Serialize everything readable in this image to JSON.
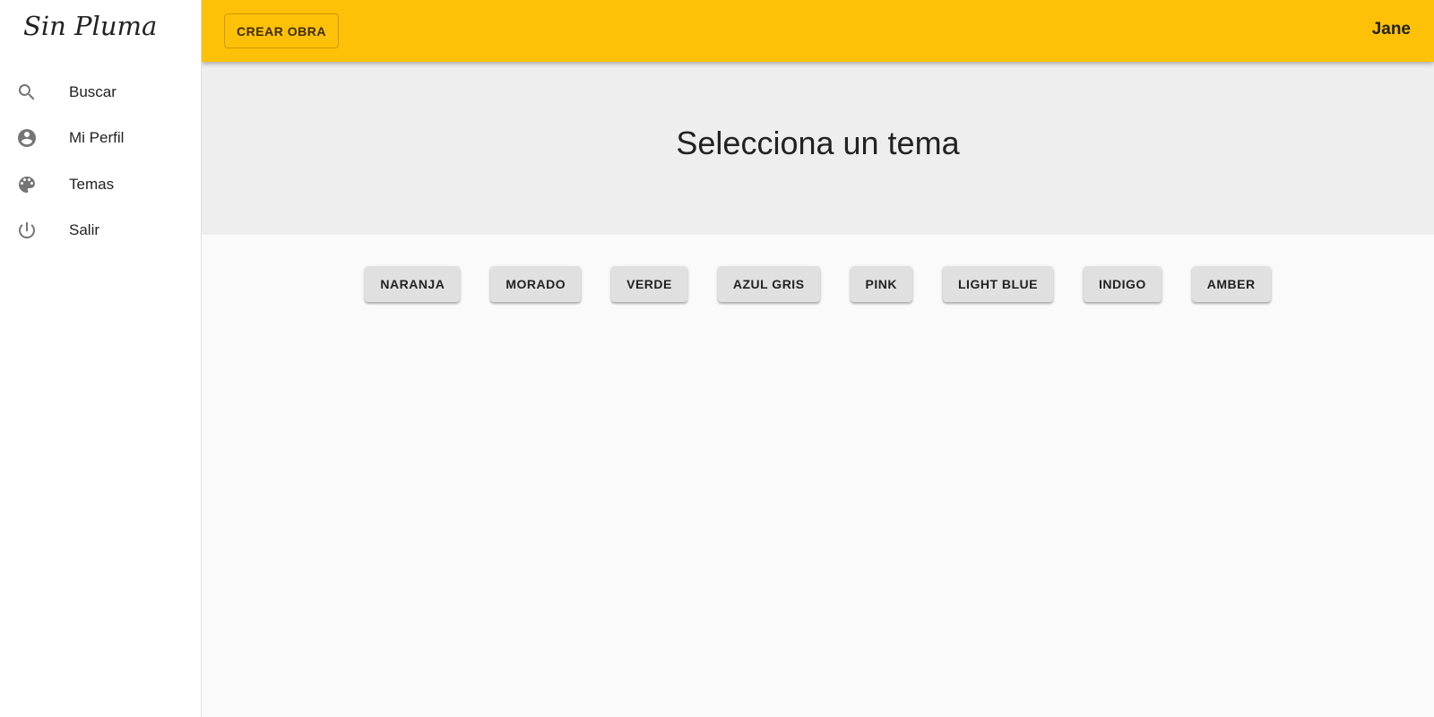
{
  "app": {
    "logo": "Sin Pluma"
  },
  "sidebar": {
    "items": [
      {
        "label": "Buscar",
        "icon": "search-icon"
      },
      {
        "label": "Mi Perfil",
        "icon": "account-circle-icon"
      },
      {
        "label": "Temas",
        "icon": "palette-icon"
      },
      {
        "label": "Salir",
        "icon": "power-icon"
      }
    ]
  },
  "header": {
    "create_label": "CREAR OBRA",
    "user": "Jane",
    "color": "#FFC107"
  },
  "main": {
    "title": "Selecciona un tema",
    "themes": [
      "NARANJA",
      "MORADO",
      "VERDE",
      "AZUL GRIS",
      "PINK",
      "LIGHT BLUE",
      "INDIGO",
      "AMBER"
    ]
  }
}
